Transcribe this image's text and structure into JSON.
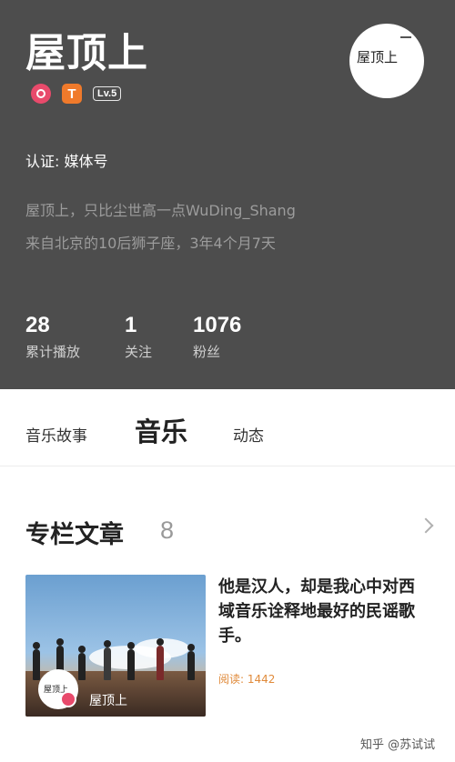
{
  "profile": {
    "name": "屋顶上",
    "level": "Lv.5",
    "certification": "认证: 媒体号",
    "bio_line1": "屋顶上，只比尘世高一点WuDing_Shang",
    "bio_line2": "来自北京的10后狮子座，3年4个月7天",
    "avatar_text": "屋顶上"
  },
  "stats": [
    {
      "value": "28",
      "label": "累计播放"
    },
    {
      "value": "1",
      "label": "关注"
    },
    {
      "value": "1076",
      "label": "粉丝"
    }
  ],
  "tabs": {
    "story": "音乐故事",
    "music": "音乐",
    "dynamic": "动态"
  },
  "section": {
    "title": "专栏文章",
    "count": "8"
  },
  "article": {
    "title": "他是汉人，却是我心中对西域音乐诠释地最好的民谣歌手。",
    "read": "阅读: 1442",
    "thumb_label": "屋顶上",
    "thumb_avatar_text": "屋顶上"
  },
  "watermark": "知乎 @苏试试",
  "colors": {
    "header_bg": "#4d4d4d",
    "badge_pink": "#e84a6b",
    "badge_orange": "#f07a2b",
    "read_accent": "#e08a3a"
  }
}
